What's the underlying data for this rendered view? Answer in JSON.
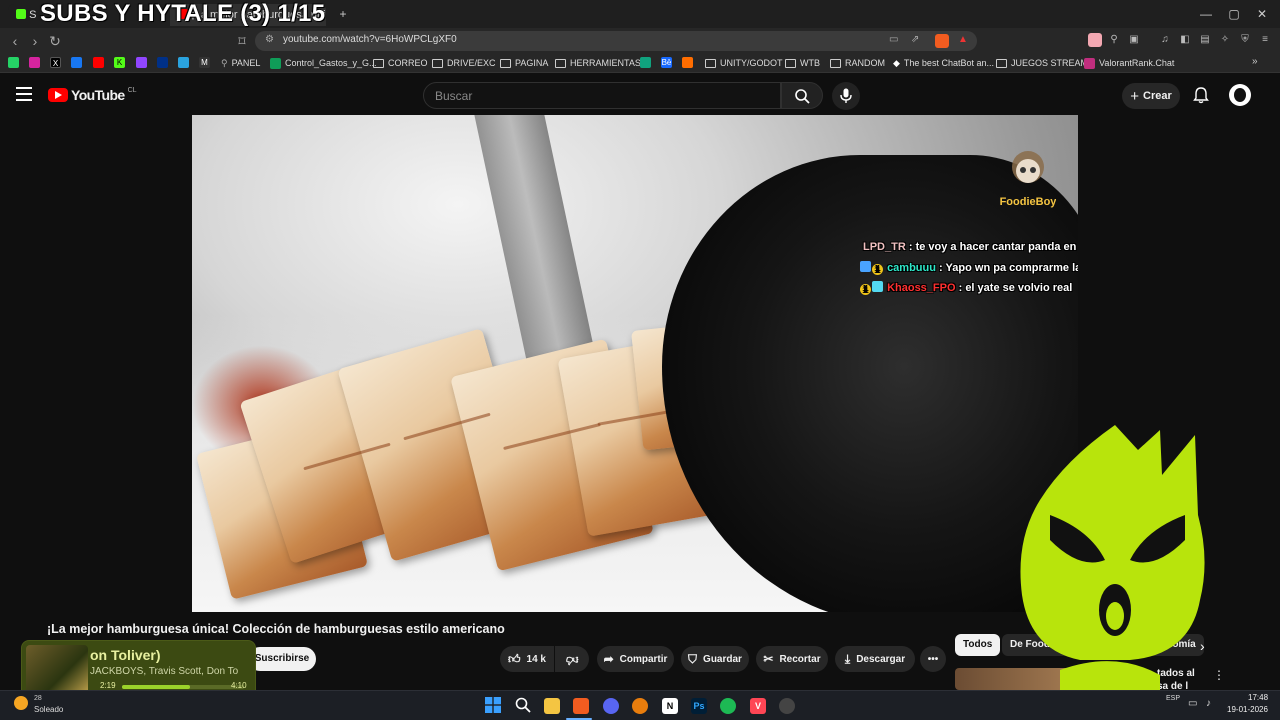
{
  "browser": {
    "overlay_title": "SUBS Y HYTALE (3) 1/15",
    "tabs": [
      {
        "label": "S"
      },
      {
        "label": "¡La mejor hamburguesa única!"
      }
    ],
    "url": "youtube.com/watch?v=6HoWPCLgXF0",
    "bookmarks": [
      "PANEL",
      "Control_Gastos_y_G...",
      "CORREO",
      "DRIVE/EXC",
      "PAGINA",
      "HERRAMIENTAS",
      "UNITY/GODOT",
      "WTB",
      "RANDOM",
      "The best ChatBot an...",
      "JUEGOS STREAM",
      "ValorantRank.Chat"
    ]
  },
  "youtube": {
    "logo": "YouTube",
    "country": "CL",
    "search_placeholder": "Buscar",
    "create_label": "Crear"
  },
  "video": {
    "title": "¡La mejor hamburguesa única! Colección de hamburguesas estilo americano",
    "watermark": "FoodieBoy",
    "chat": [
      {
        "user": "LPD_TR",
        "message": ": te voy a hacer cantar panda en ripley",
        "color": "#f0c0c0"
      },
      {
        "user": "cambuuu",
        "message": ": Yapo wn pa comprarme la Xbox",
        "color": "#2ee6c8"
      },
      {
        "user": "Khaoss_FPO",
        "message": ": el yate se volvio real",
        "color": "#ff3030"
      }
    ]
  },
  "actions": {
    "subscribe": "Suscribirse",
    "likes": "14 k",
    "share": "Compartir",
    "save": "Guardar",
    "clip": "Recortar",
    "download": "Descargar"
  },
  "chips": [
    "Todos",
    "De FoodieBoy",
    "Gastronomía"
  ],
  "recommended": {
    "title_partial": "tados al",
    "subtitle_partial": "sa de l"
  },
  "music": {
    "track_partial": "on Toliver)",
    "artists_partial": "JACKBOYS, Travis Scott, Don To",
    "elapsed": "2:19",
    "duration": "4:10",
    "progress": 0.556
  },
  "taskbar": {
    "weather": "Soleado",
    "weather_temp": "28",
    "lang": "ESP",
    "time": "17:48",
    "date": "19-01-2026"
  }
}
